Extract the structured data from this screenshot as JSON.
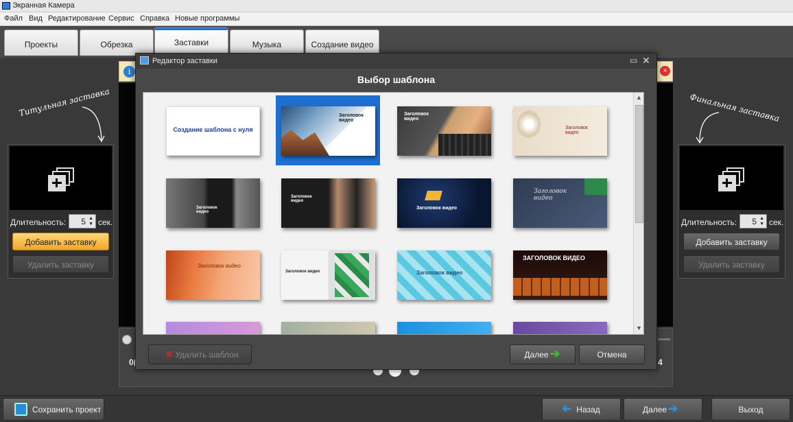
{
  "window": {
    "title": "Экранная Камера"
  },
  "menu": [
    "Файл",
    "Вид",
    "Редактирование",
    "Сервис",
    "Справка",
    "Новые программы"
  ],
  "tabs": [
    "Проекты",
    "Обрезка",
    "Заставки",
    "Музыка",
    "Создание видео"
  ],
  "left_panel": {
    "caption": "Титульная заставка",
    "duration_label": "Длительность:",
    "duration_value": "5",
    "unit": "сек.",
    "add_button": "Добавить заставку",
    "remove_button": "Удалить заставку"
  },
  "right_panel": {
    "caption": "Финальная заставка",
    "duration_label": "Длительность:",
    "duration_value": "5",
    "unit": "сек.",
    "add_button": "Добавить заставку",
    "remove_button": "Удалить заставку"
  },
  "timeline": {
    "start_fragment": "0(",
    "end_fragment": "4"
  },
  "dialog": {
    "title": "Редактор заставки",
    "heading": "Выбор шаблона",
    "delete_button": "Удалить шаблон",
    "next_button": "Далее",
    "cancel_button": "Отмена",
    "templates": [
      {
        "text": "Создание шаблона с нуля",
        "selected": false
      },
      {
        "text": "Заголовок видео",
        "selected": true
      },
      {
        "text": "Заголовок видео",
        "selected": false
      },
      {
        "text": "Заголовок видео",
        "selected": false
      },
      {
        "text": "Заголовок видео",
        "selected": false
      },
      {
        "text": "Заголовок видео",
        "selected": false
      },
      {
        "text": "Заголовок видео",
        "selected": false
      },
      {
        "text": "Заголовок видео",
        "selected": false
      },
      {
        "text": "Заголовок видео",
        "selected": false
      },
      {
        "text": "Заголовок видео",
        "selected": false
      },
      {
        "text": "Заголовок видео",
        "selected": false
      },
      {
        "text": "ЗАГОЛОВОК ВИДЕО",
        "selected": false
      }
    ]
  },
  "footer": {
    "save_button": "Сохранить проект",
    "back_button": "Назад",
    "next_button": "Далее",
    "exit_button": "Выход"
  },
  "colors": {
    "accent": "#1f6fd0",
    "orange": "#f3a628",
    "green_arrow": "#3bbf2e",
    "blue_arrow": "#2e8fe0"
  }
}
